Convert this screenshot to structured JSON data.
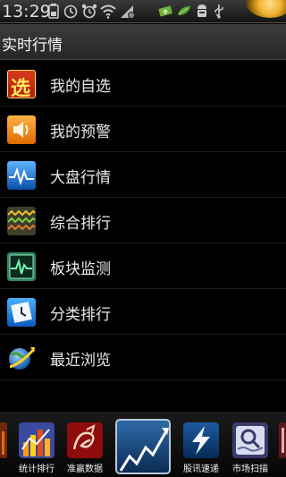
{
  "status_bar": {
    "time": "13:29",
    "icons": [
      "battery-icon",
      "clock-icon",
      "alarm-icon",
      "wifi-icon",
      "signal-icon",
      "money-icon",
      "leaf-icon",
      "usb-icon",
      "usb-debug-icon"
    ]
  },
  "header": {
    "title": "实时行情"
  },
  "menu": {
    "items": [
      {
        "label": "我的自选",
        "icon": "select-icon"
      },
      {
        "label": "我的预警",
        "icon": "speaker-icon"
      },
      {
        "label": "大盘行情",
        "icon": "wave-icon"
      },
      {
        "label": "综合排行",
        "icon": "multi-wave-icon"
      },
      {
        "label": "板块监测",
        "icon": "monitor-icon"
      },
      {
        "label": "分类排行",
        "icon": "clock-icon"
      },
      {
        "label": "最近浏览",
        "icon": "globe-icon"
      }
    ],
    "select_glyph": "选"
  },
  "dock": {
    "items": [
      {
        "label": "统计排行",
        "icon": "bar-chart-icon"
      },
      {
        "label": "准赢数据",
        "icon": "dragon-icon"
      },
      {
        "label": "",
        "icon": "trend-chart-icon"
      },
      {
        "label": "股讯速递",
        "icon": "lightning-icon"
      },
      {
        "label": "市场扫描",
        "icon": "scan-icon"
      }
    ]
  }
}
